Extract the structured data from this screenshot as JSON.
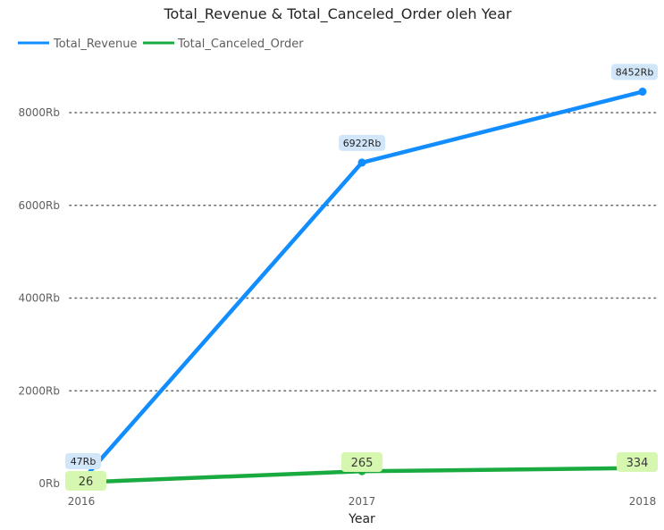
{
  "chart_data": {
    "type": "line",
    "title": "Total_Revenue & Total_Canceled_Order oleh Year",
    "xlabel": "Year",
    "ylabel": "",
    "x": [
      "2016",
      "2017",
      "2018"
    ],
    "ylim": [
      0,
      8000
    ],
    "y_ticks": [
      0,
      2000,
      4000,
      6000,
      8000
    ],
    "y_tick_labels": [
      "0Rb",
      "2000Rb",
      "4000Rb",
      "6000Rb",
      "8000Rb"
    ],
    "grid": "horizontal dotted",
    "legend_position": "top-left",
    "series": [
      {
        "name": "Total_Revenue",
        "color": "#118DFF",
        "label_bg": "#D2E6FA",
        "values": [
          47,
          6922,
          8452
        ],
        "labels": [
          "47Rb",
          "6922Rb",
          "8452Rb"
        ]
      },
      {
        "name": "Total_Canceled_Order",
        "color": "#1AAB40",
        "label_bg": "#D5F7B0",
        "values": [
          26,
          265,
          334
        ],
        "labels": [
          "26",
          "265",
          "334"
        ]
      }
    ]
  }
}
